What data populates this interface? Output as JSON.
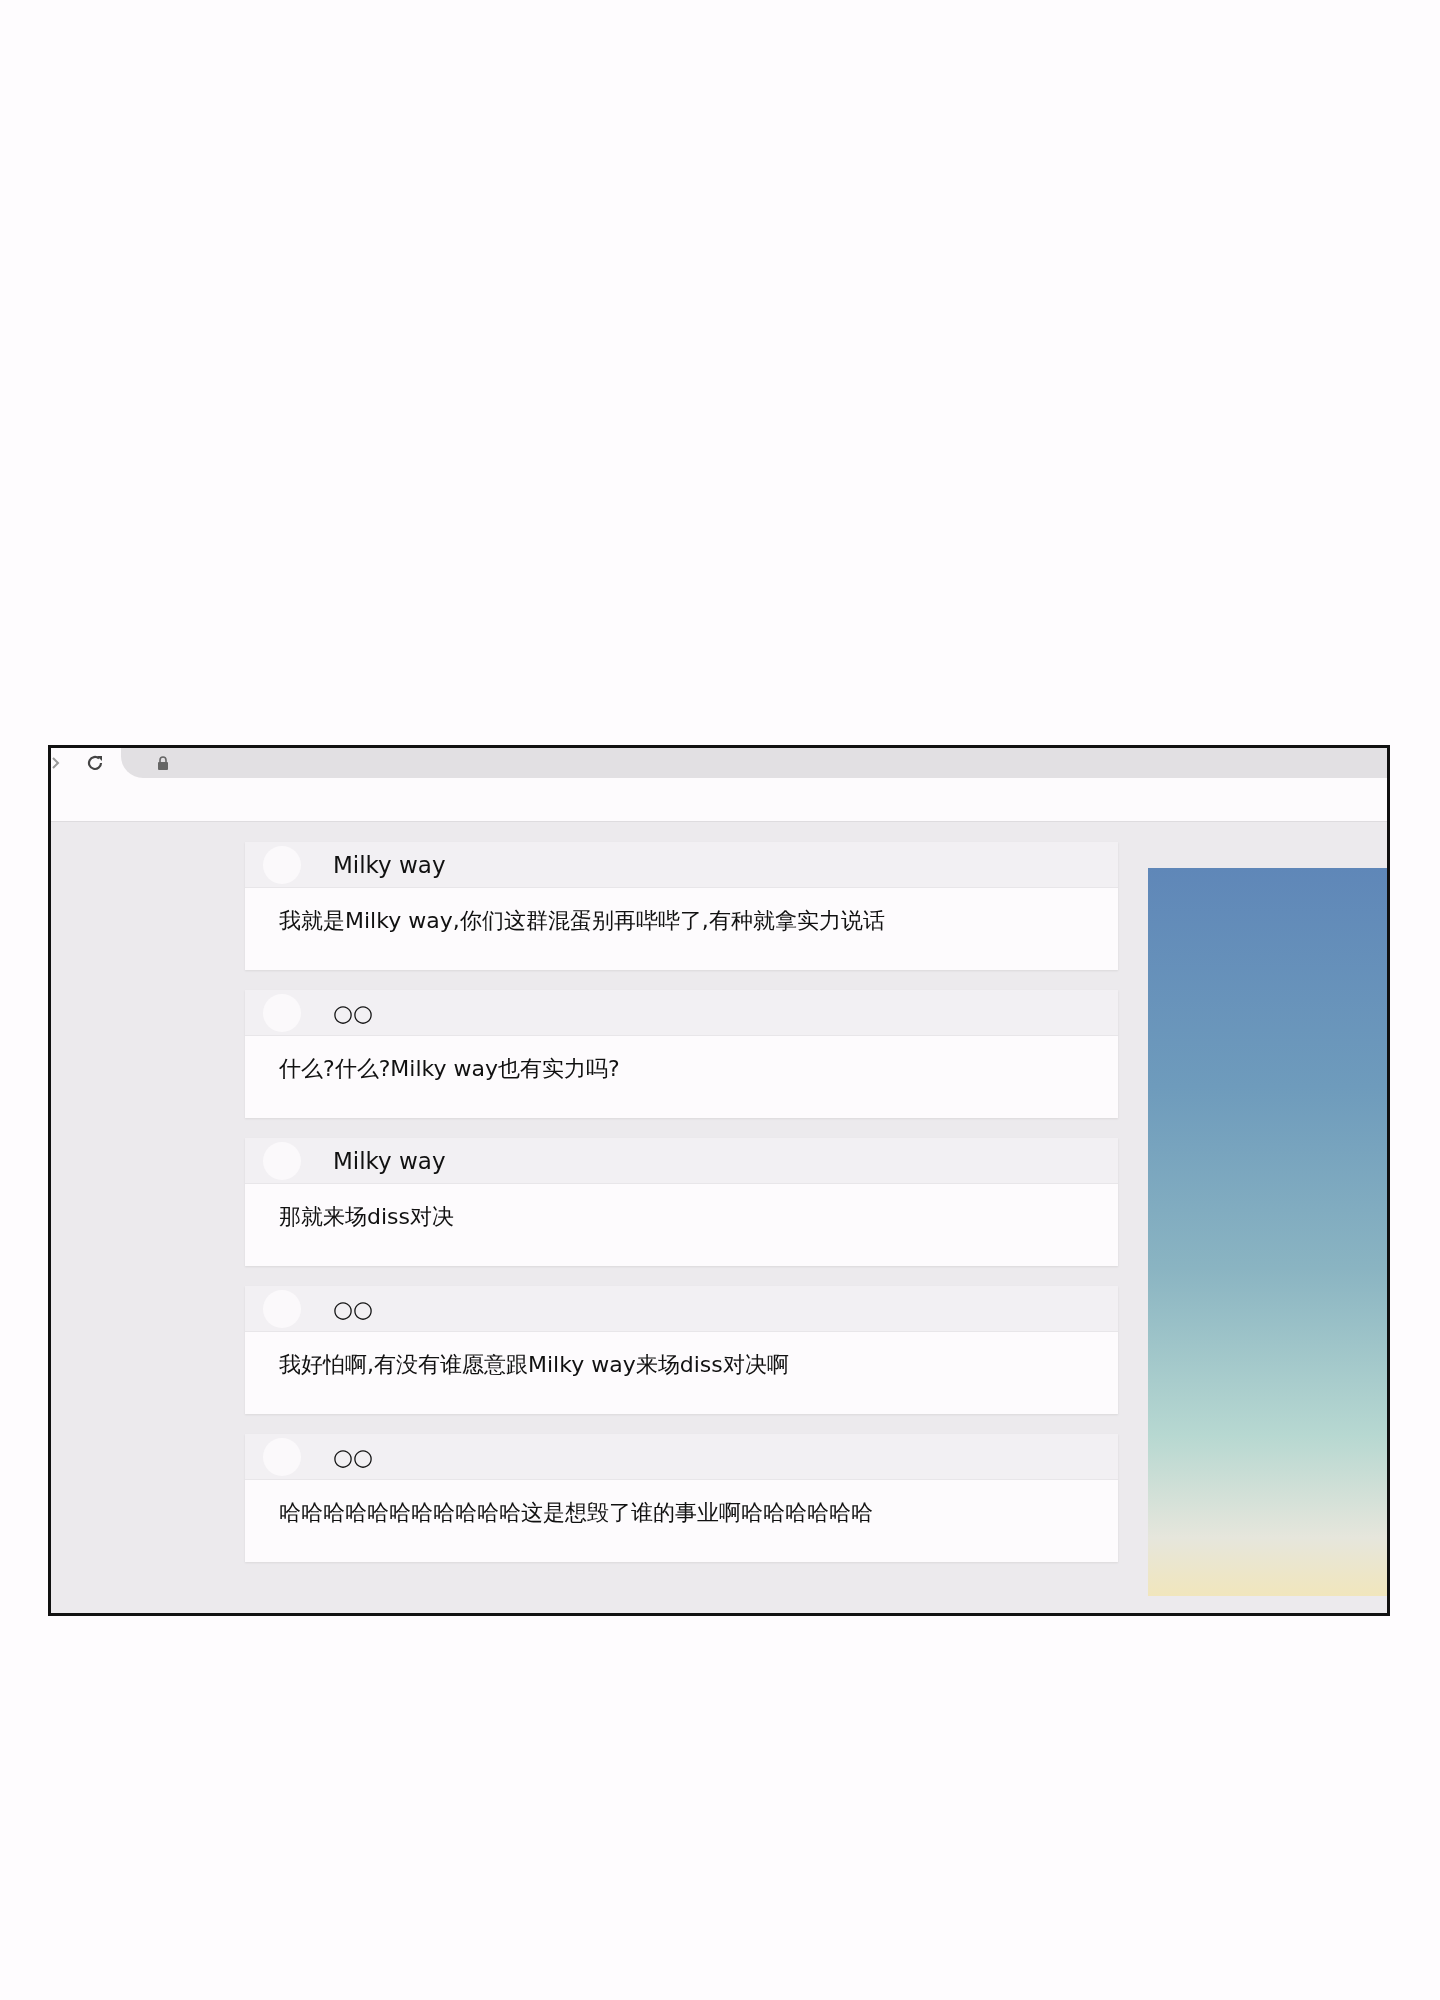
{
  "messages": [
    {
      "author": "Milky way",
      "text": "我就是Milky way,你们这群混蛋别再哔哔了,有种就拿实力说话"
    },
    {
      "author": "○○",
      "text": "什么?什么?Milky way也有实力吗?"
    },
    {
      "author": "Milky way",
      "text": "那就来场diss对决"
    },
    {
      "author": "○○",
      "text": "我好怕啊,有没有谁愿意跟Milky way来场diss对决啊"
    },
    {
      "author": "○○",
      "text": "哈哈哈哈哈哈哈哈哈哈哈这是想毁了谁的事业啊哈哈哈哈哈哈"
    }
  ]
}
